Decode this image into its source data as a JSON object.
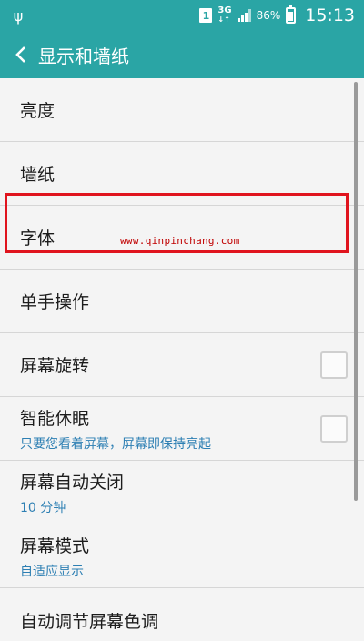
{
  "status_bar": {
    "usb_icon": "usb-icon",
    "sim_label": "1",
    "network_type": "3G",
    "network_sub": "↓↑",
    "battery_percent": "86%",
    "time": "15:13",
    "color": "#2aa5a5"
  },
  "app_bar": {
    "back_icon": "chevron-left-icon",
    "title": "显示和墙纸"
  },
  "settings": [
    {
      "label": "亮度"
    },
    {
      "label": "墙纸"
    },
    {
      "label": "字体"
    },
    {
      "label": "单手操作"
    },
    {
      "label": "屏幕旋转",
      "checkbox": false
    },
    {
      "label": "智能休眠",
      "sub": "只要您看着屏幕，屏幕即保持亮起",
      "checkbox": false
    },
    {
      "label": "屏幕自动关闭",
      "sub": "10 分钟"
    },
    {
      "label": "屏幕模式",
      "sub": "自适应显示"
    },
    {
      "label": "自动调节屏幕色调",
      "checkbox": true
    }
  ],
  "watermark": "www.qinpinchang.com"
}
